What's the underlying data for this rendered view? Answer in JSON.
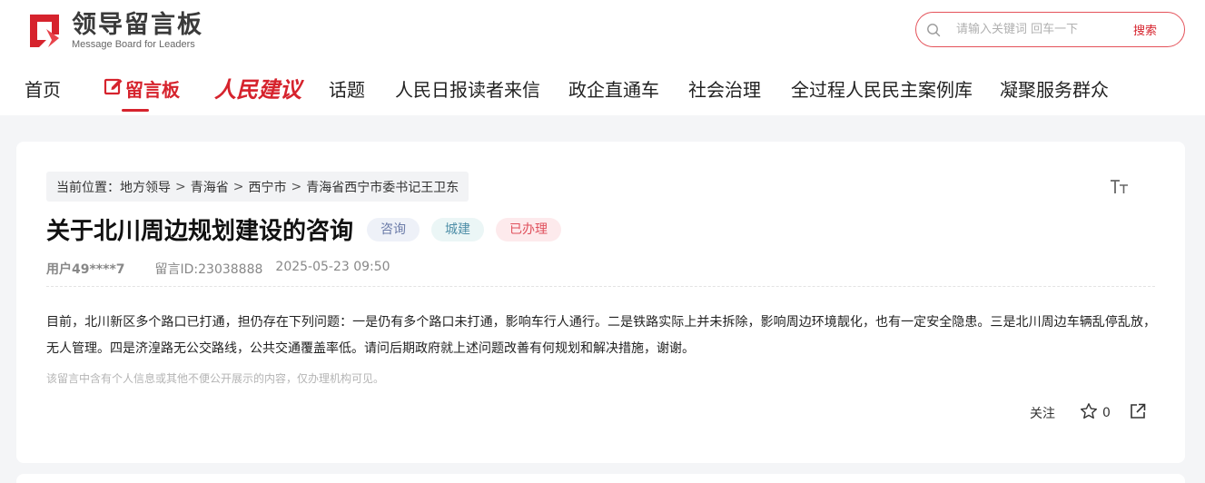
{
  "brand": {
    "title": "领导留言板",
    "subtitle": "Message Board for Leaders",
    "accent": "#d6232d"
  },
  "search": {
    "placeholder": "请输入关键词 回车一下",
    "button": "搜索"
  },
  "nav": {
    "items": [
      {
        "label": "首页",
        "active": false
      },
      {
        "label": "留言板",
        "active": true,
        "icon": "edit-icon"
      },
      {
        "label": "人民建议",
        "active": false
      },
      {
        "label": "话题",
        "active": false
      },
      {
        "label": "人民日报读者来信",
        "active": false
      },
      {
        "label": "政企直通车",
        "active": false
      },
      {
        "label": "社会治理",
        "active": false
      },
      {
        "label": "全过程人民民主案例库",
        "active": false
      },
      {
        "label": "凝聚服务群众",
        "active": false
      }
    ]
  },
  "breadcrumb": {
    "prefix": "当前位置：",
    "items": [
      "地方领导",
      "青海省",
      "西宁市",
      "青海省西宁市委书记王卫东"
    ],
    "separator": ">"
  },
  "message": {
    "title": "关于北川周边规划建设的咨询",
    "tags": {
      "type": "咨询",
      "domain": "城建",
      "status": "已办理"
    },
    "user": "用户49****7",
    "message_id": "留言ID:23038888",
    "time": "2025-05-23 09:50",
    "content": "目前，北川新区多个路口已打通，担仍存在下列问题：一是仍有多个路口未打通，影响车行人通行。二是铁路实际上并未拆除，影响周边环境靓化，也有一定安全隐患。三是北川周边车辆乱停乱放，无人管理。四是济湟路无公交路线，公共交通覆盖率低。请问后期政府就上述问题改善有何规划和解决措施，谢谢。",
    "privacy_note": "该留言中含有个人信息或其他不便公开展示的内容，仅办理机构可见。"
  },
  "actions": {
    "follow": "关注",
    "star_count": "0",
    "star_icon": "star-icon",
    "share_icon": "share-icon",
    "font_size_icon": "font-size-icon"
  }
}
